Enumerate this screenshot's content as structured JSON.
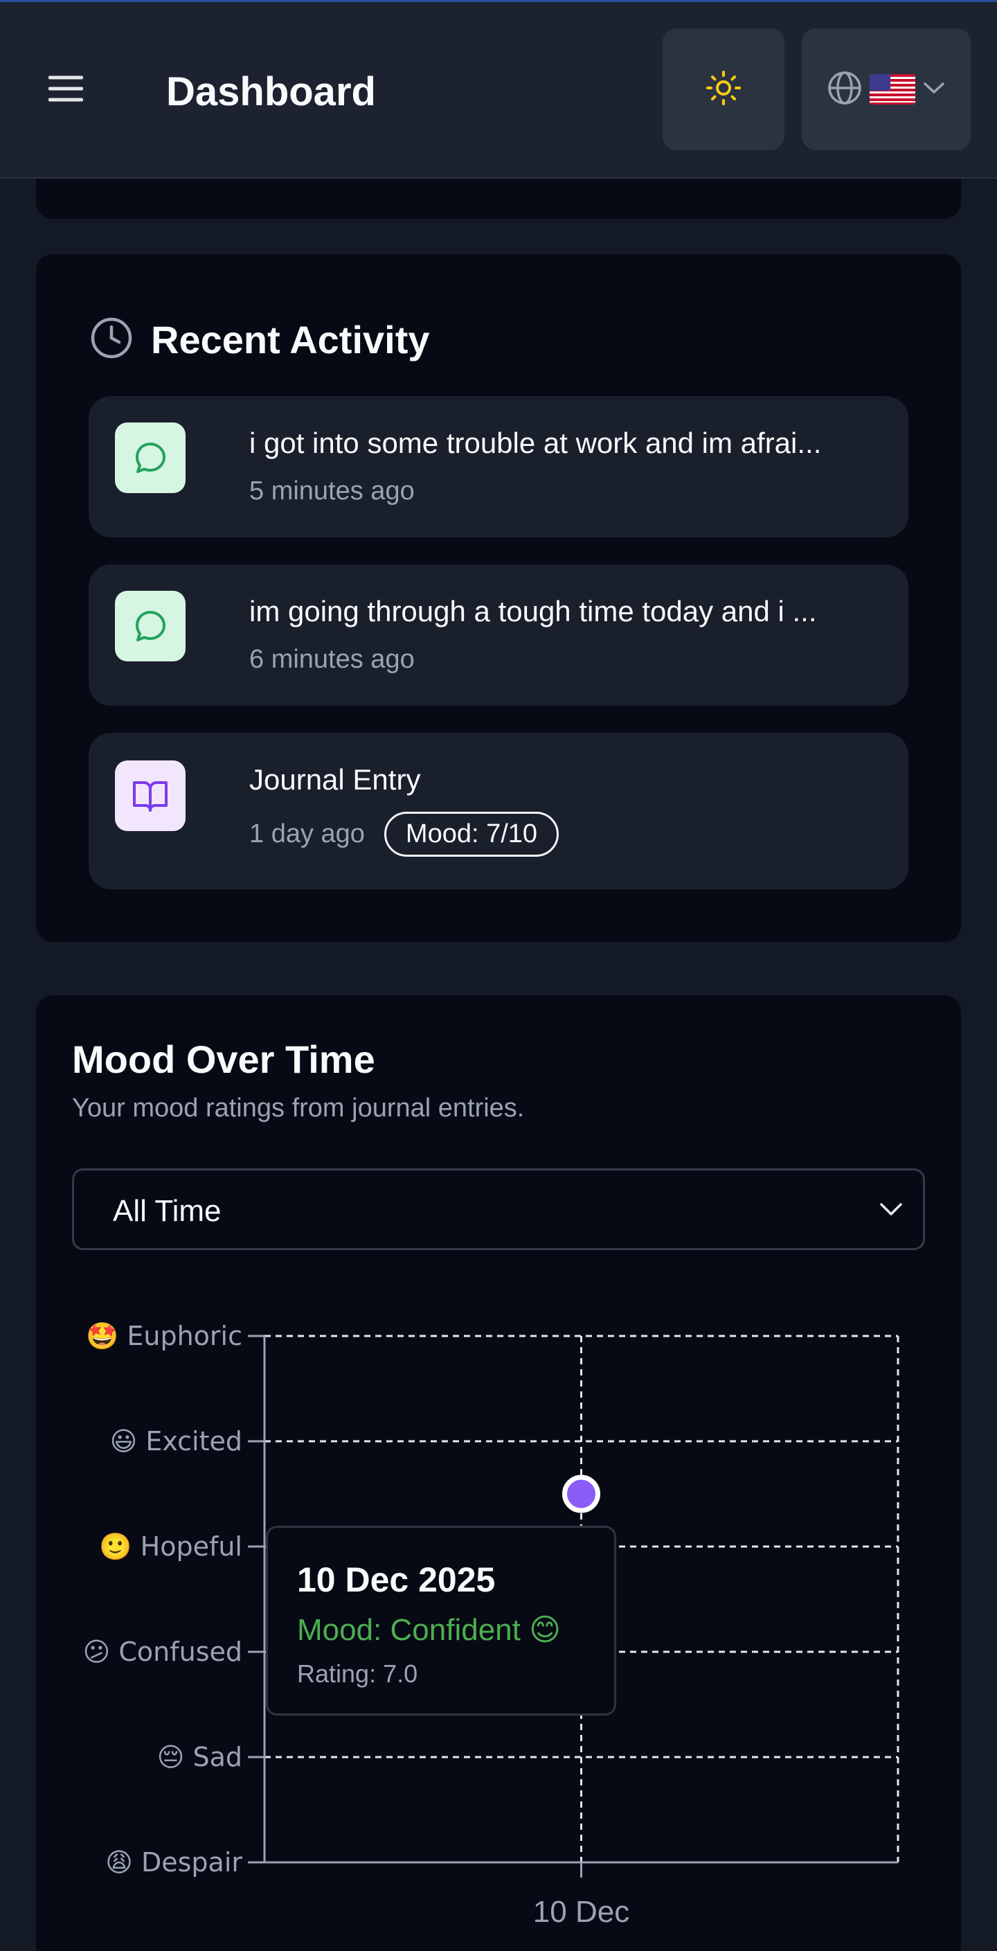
{
  "header": {
    "title": "Dashboard",
    "menu_icon": "hamburger-menu-icon",
    "theme_icon": "sun-icon",
    "language_icon": "globe-icon",
    "flag": "us-flag",
    "sun_color": "#facc15"
  },
  "recent_activity": {
    "title": "Recent Activity",
    "icon": "clock-icon",
    "items": [
      {
        "type": "chat",
        "icon": "message-circle-icon",
        "text": "i got into some trouble at work and im afrai...",
        "time": "5 minutes ago"
      },
      {
        "type": "chat",
        "icon": "message-circle-icon",
        "text": "im going through a tough time today and i ...",
        "time": "6 minutes ago"
      },
      {
        "type": "journal",
        "icon": "book-open-icon",
        "text": "Journal Entry",
        "time": "1 day ago",
        "badge": "Mood: 7/10"
      }
    ]
  },
  "mood_chart": {
    "title": "Mood Over Time",
    "description": "Your mood ratings from journal entries.",
    "range_selected": "All Time",
    "tooltip": {
      "date": "10 Dec 2025",
      "mood": "Mood: Confident 😊",
      "rating": "Rating: 7.0"
    }
  },
  "chart_data": {
    "type": "scatter",
    "title": "Mood Over Time",
    "x": [
      "10 Dec"
    ],
    "y_categories": [
      {
        "label": "🤩 Euphoric",
        "value": 10
      },
      {
        "label": "😃 Excited",
        "value": 8
      },
      {
        "label": "🙂 Hopeful",
        "value": 6
      },
      {
        "label": "😕 Confused",
        "value": 4
      },
      {
        "label": "😔 Sad",
        "value": 2
      },
      {
        "label": "😩 Despair",
        "value": 0
      }
    ],
    "series": [
      {
        "values": [
          7.0
        ]
      }
    ],
    "ylim": [
      0,
      10
    ],
    "grid": true,
    "point_color": "#8b5cf6"
  }
}
